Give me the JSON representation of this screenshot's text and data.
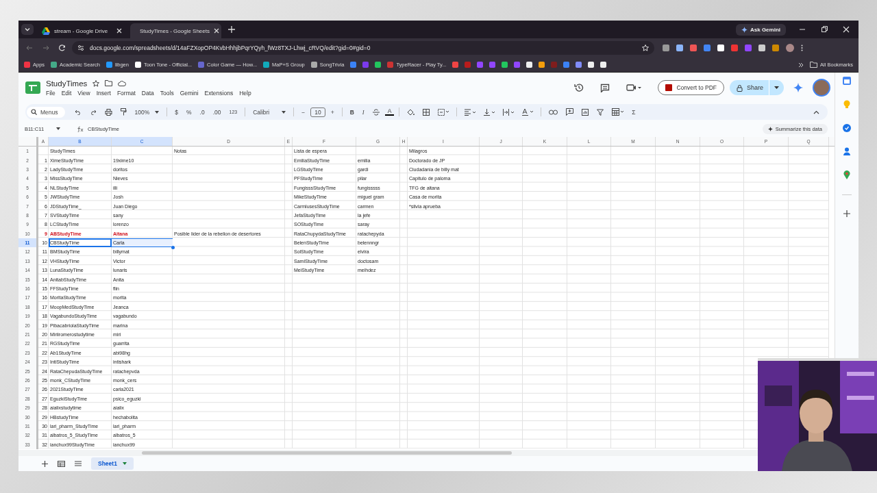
{
  "browser": {
    "tabs": [
      {
        "title": "stream - Google Drive",
        "selected": false
      },
      {
        "title": "StudyTimes - Google Sheets",
        "selected": true
      }
    ],
    "ask_gemini": "Ask Gemini",
    "url": "docs.google.com/spreadsheets/d/14aFZXopOP4KvbHhhjbPqrYQyh_fWz8TXJ-Lhwj_cRVQ/edit?gid=0#gid=0",
    "bookmarks": [
      {
        "label": "Apps"
      },
      {
        "label": "Academic Search"
      },
      {
        "label": "libgen"
      },
      {
        "label": "Toon Tone - Official..."
      },
      {
        "label": "Color Game — How..."
      },
      {
        "label": "MaP+S Group"
      },
      {
        "label": "SongTrivia"
      },
      {
        "label": "TypeRacer - Play Ty..."
      }
    ],
    "all_bookmarks": "All Bookmarks"
  },
  "document": {
    "title": "StudyTimes",
    "menu": [
      "File",
      "Edit",
      "View",
      "Insert",
      "Format",
      "Data",
      "Tools",
      "Gemini",
      "Extensions",
      "Help"
    ],
    "convert_pdf": "Convert to PDF",
    "share": "Share"
  },
  "toolbar": {
    "search": "Menus",
    "zoom": "100%",
    "currency": "$",
    "percent": "%",
    "decrease_decimals": ".0",
    "increase_decimals": ".00",
    "number_format": "123",
    "font": "Calibri",
    "minus": "−",
    "font_size": "10",
    "plus": "+",
    "bold": "B",
    "italic": "I",
    "text_color": "A",
    "sum": "Σ"
  },
  "formula_bar": {
    "name_box": "B11:C11",
    "value": "CBStudyTime"
  },
  "summarize": "Summarize this data",
  "table": {
    "columns": [
      {
        "label": "A",
        "selected": false
      },
      {
        "label": "B",
        "selected": true
      },
      {
        "label": "C",
        "selected": true
      },
      {
        "label": "D",
        "selected": false
      },
      {
        "label": "E",
        "selected": false
      },
      {
        "label": "F",
        "selected": false
      },
      {
        "label": "G",
        "selected": false
      },
      {
        "label": "H",
        "selected": false
      },
      {
        "label": "I",
        "selected": false
      },
      {
        "label": "J",
        "selected": false
      },
      {
        "label": "K",
        "selected": false
      },
      {
        "label": "L",
        "selected": false
      },
      {
        "label": "M",
        "selected": false
      },
      {
        "label": "N",
        "selected": false
      },
      {
        "label": "O",
        "selected": false
      },
      {
        "label": "P",
        "selected": false
      },
      {
        "label": "Q",
        "selected": false
      }
    ],
    "rows": [
      {
        "header": "1",
        "selected": false,
        "cells": {
          "B": "StudyTimes",
          "D": "Notas",
          "F": "Lista de espera",
          "I": "Milagros"
        }
      },
      {
        "header": "2",
        "selected": false,
        "cells": {
          "A": "1",
          "B": "XimeStudyTime",
          "C": "19xime10",
          "F": "EmiliaStudyTime",
          "G": "emilia",
          "I": "Doctorado de JP"
        }
      },
      {
        "header": "3",
        "selected": false,
        "cells": {
          "A": "2",
          "B": "LadyStudyTime",
          "C": "doritos",
          "F": "LGStudyTime",
          "G": "gardi",
          "I": "Ciudadania de billy mat"
        }
      },
      {
        "header": "4",
        "selected": false,
        "cells": {
          "A": "3",
          "B": "MissStudyTime",
          "C": "Nieves",
          "F": "PFStudyTime",
          "G": "pilar",
          "I": "Capitulo de paloma"
        }
      },
      {
        "header": "5",
        "selected": false,
        "cells": {
          "A": "4",
          "B": "NLStudyTime",
          "C": "illi",
          "F": "FungisssStudyTime",
          "G": "fungisssss",
          "I": "TFG de aitana"
        }
      },
      {
        "header": "6",
        "selected": false,
        "cells": {
          "A": "5",
          "B": "JWStudyTime",
          "C": "Josh",
          "F": "MikeStudyTime",
          "G": "miguel gram",
          "I": "Casa de morita"
        }
      },
      {
        "header": "7",
        "selected": false,
        "cells": {
          "A": "6",
          "B": "JDStudyTime_",
          "C": "Juan Diego",
          "F": "CarmlusesStudyTime",
          "G": "carmen",
          "I": "*silvia aprueba"
        }
      },
      {
        "header": "8",
        "selected": false,
        "cells": {
          "A": "7",
          "B": "SVStudyTime",
          "C": "sany",
          "F": "JefaStudyTime",
          "G": "la jefe"
        }
      },
      {
        "header": "9",
        "selected": false,
        "cells": {
          "A": "8",
          "B": "LCStudyTime",
          "C": "lorenzo",
          "F": "SOStudyTime",
          "G": "saray"
        }
      },
      {
        "header": "10",
        "selected": false,
        "cells": {
          "A": {
            "text": "9",
            "flagged": true
          },
          "B": {
            "text": "ABStudyTime",
            "flagged": true
          },
          "C": {
            "text": "Aitana",
            "flagged": true
          },
          "D": "Posible lider de la rebelion de desertores",
          "F": "RataChupydaStudyTime",
          "G": "ratachepyda"
        }
      },
      {
        "header": "11",
        "selected": true,
        "cells": {
          "A": "10",
          "B": "CBStudyTime",
          "C": "Carla",
          "F": "BelenStudyTime",
          "G": "belennngr"
        }
      },
      {
        "header": "12",
        "selected": false,
        "cells": {
          "A": "11",
          "B": "BMStudyTime",
          "C": "billymat",
          "F": "SolStudyTime",
          "G": "elvira"
        }
      },
      {
        "header": "13",
        "selected": false,
        "cells": {
          "A": "12",
          "B": "VHStudyTime",
          "C": "Victor",
          "F": "SamiStudyTime",
          "G": "doctosam"
        }
      },
      {
        "header": "14",
        "selected": false,
        "cells": {
          "A": "13",
          "B": "LunaStudyTime",
          "C": "lunaris",
          "F": "MeiStudyTime",
          "G": "meihdez"
        }
      },
      {
        "header": "15",
        "selected": false,
        "cells": {
          "A": "14",
          "B": "AnitabStudyTime",
          "C": "Anita"
        }
      },
      {
        "header": "16",
        "selected": false,
        "cells": {
          "A": "15",
          "B": "FFStudyTime",
          "C": "flin"
        }
      },
      {
        "header": "17",
        "selected": false,
        "cells": {
          "A": "16",
          "B": "MoritaStudyTime",
          "C": "morita"
        }
      },
      {
        "header": "18",
        "selected": false,
        "cells": {
          "A": "17",
          "B": "MoopMedStudyTime",
          "C": "Jeanca"
        }
      },
      {
        "header": "19",
        "selected": false,
        "cells": {
          "A": "18",
          "B": "VagabundoStudyTime",
          "C": "vagabundo"
        }
      },
      {
        "header": "20",
        "selected": false,
        "cells": {
          "A": "19",
          "B": "PibacabriolaStudyTime",
          "C": "marina"
        }
      },
      {
        "header": "21",
        "selected": false,
        "cells": {
          "A": "20",
          "B": "Miriiromerostudytime",
          "C": "miri"
        }
      },
      {
        "header": "22",
        "selected": false,
        "cells": {
          "A": "21",
          "B": "RGStudyTime",
          "C": "guarrita"
        }
      },
      {
        "header": "23",
        "selected": false,
        "cells": {
          "A": "22",
          "B": "Ab1StudyTime",
          "C": "abi98hg"
        }
      },
      {
        "header": "24",
        "selected": false,
        "cells": {
          "A": "23",
          "B": "IntiStudyTime",
          "C": "intishark"
        }
      },
      {
        "header": "25",
        "selected": false,
        "cells": {
          "A": "24",
          "B": "RataChepudaStudyTime",
          "C": "ratachepvda"
        }
      },
      {
        "header": "26",
        "selected": false,
        "cells": {
          "A": "25",
          "B": "monk_CStudyTime",
          "C": "monk_cers"
        }
      },
      {
        "header": "27",
        "selected": false,
        "cells": {
          "A": "26",
          "B": "2021StudyTime",
          "C": "carla2021"
        }
      },
      {
        "header": "28",
        "selected": false,
        "cells": {
          "A": "27",
          "B": "EguzkiStudyTime",
          "C": "psico_eguzki"
        }
      },
      {
        "header": "29",
        "selected": false,
        "cells": {
          "A": "28",
          "B": "aialixstudytime",
          "C": "aialix"
        }
      },
      {
        "header": "30",
        "selected": false,
        "cells": {
          "A": "29",
          "B": "HBstudyTime",
          "C": "hechabolita"
        }
      },
      {
        "header": "31",
        "selected": false,
        "cells": {
          "A": "30",
          "B": "lari_pharm_StudyTime",
          "C": "lari_pharm"
        }
      },
      {
        "header": "32",
        "selected": false,
        "cells": {
          "A": "31",
          "B": "albatros_5_StudyTime",
          "C": "albatros_5"
        }
      },
      {
        "header": "33",
        "selected": false,
        "cells": {
          "A": "32",
          "B": "ianchux99StudyTime",
          "C": "ianchux99"
        }
      }
    ]
  },
  "sheets": [
    {
      "name": "Sheet1",
      "selected": true
    }
  ]
}
